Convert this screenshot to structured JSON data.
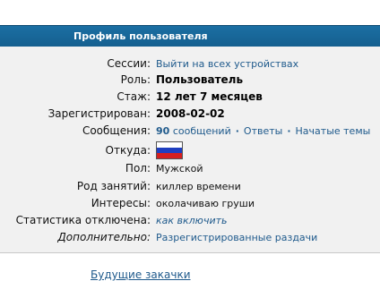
{
  "header": {
    "title": "Профиль пользователя"
  },
  "profile": {
    "sessions": {
      "label": "Сессии:",
      "action": "Выйти на всех устройствах"
    },
    "role": {
      "label": "Роль:",
      "value": "Пользователь"
    },
    "tenure": {
      "label": "Стаж:",
      "value": "12 лет 7 месяцев"
    },
    "registered": {
      "label": "Зарегистрирован:",
      "value": "2008-02-02"
    },
    "messages": {
      "label": "Сообщения:",
      "count": "90",
      "count_suffix": "сообщений",
      "answers": "Ответы",
      "topics": "Начатые темы"
    },
    "origin": {
      "label": "Откуда:",
      "flag": "russia-flag"
    },
    "gender": {
      "label": "Пол:",
      "value": "Мужской"
    },
    "occupation": {
      "label": "Род занятий:",
      "value": "киллер времени"
    },
    "interests": {
      "label": "Интересы:",
      "value": "околачиваю груши"
    },
    "stats_disabled": {
      "label": "Статистика отключена:",
      "action": "как включить"
    },
    "additional": {
      "label": "Дополнительно:",
      "action": "Разрегистрированные раздачи"
    }
  },
  "footer": {
    "link": "Будущие закачки"
  },
  "colors": {
    "header_bg": "#1b6fa3",
    "link": "#1f5a8c",
    "panel_bg": "#f1f1f1"
  }
}
